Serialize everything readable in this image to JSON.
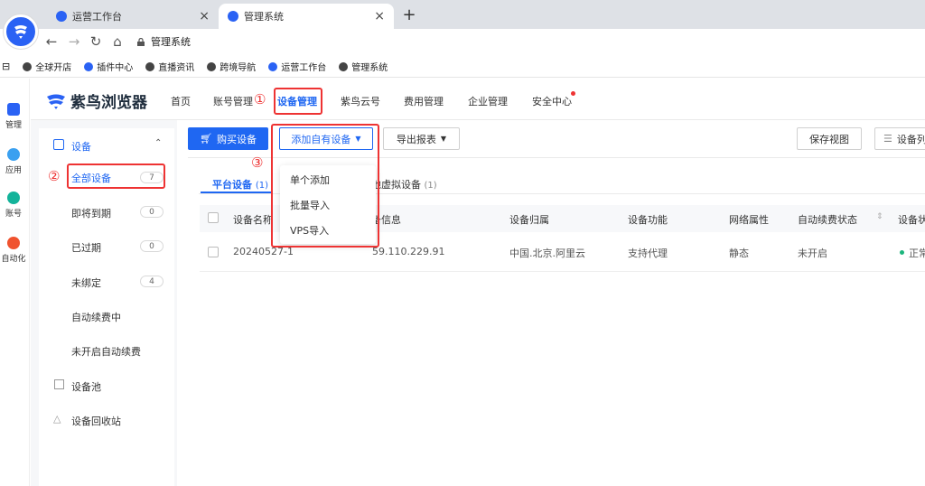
{
  "tabs": [
    {
      "label": "运营工作台"
    },
    {
      "label": "管理系统"
    }
  ],
  "address": "管理系统",
  "bookmarks": [
    "全球开店",
    "插件中心",
    "直播资讯",
    "跨境导航",
    "运营工作台",
    "管理系统"
  ],
  "rail": [
    {
      "label": "管理"
    },
    {
      "label": "应用"
    },
    {
      "label": "账号"
    },
    {
      "label": "自动化"
    }
  ],
  "app": {
    "name": "紫鸟浏览器"
  },
  "topnav": [
    "首页",
    "账号管理",
    "设备管理",
    "紫鸟云号",
    "费用管理",
    "企业管理",
    "安全中心"
  ],
  "annotations": [
    "①",
    "②",
    "③"
  ],
  "sidemenu": {
    "group": "设备",
    "items": [
      {
        "label": "全部设备",
        "count": "7"
      },
      {
        "label": "即将到期",
        "count": "0"
      },
      {
        "label": "已过期",
        "count": "0"
      },
      {
        "label": "未绑定",
        "count": "4"
      },
      {
        "label": "自动续费中"
      },
      {
        "label": "未开启自动续费"
      }
    ],
    "pool": "设备池",
    "recycle": "设备回收站"
  },
  "toolbar": {
    "buy": "购买设备",
    "add_own": "添加自有设备",
    "export": "导出报表",
    "save_view": "保存视图",
    "columns": "设备列"
  },
  "dropdown": [
    "单个添加",
    "批量导入",
    "VPS导入"
  ],
  "subtabs": [
    {
      "label": "平台设备",
      "count": "(1)"
    },
    {
      "label": "本地虚拟设备",
      "count": "(1)"
    }
  ],
  "table": {
    "headers": [
      "设备名称",
      "设备信息",
      "设备归属",
      "设备功能",
      "网络属性",
      "自动续费状态",
      "设备状"
    ],
    "rows": [
      {
        "name": "20240527-1",
        "info": "59.110.229.91",
        "location": "中国.北京.阿里云",
        "function": "支持代理",
        "network": "静态",
        "auto_renew": "未开启",
        "status": "正常"
      }
    ]
  },
  "colors": {
    "accent": "#1f67f2",
    "highlight": "#e33",
    "status_ok": "#1bb57c"
  }
}
